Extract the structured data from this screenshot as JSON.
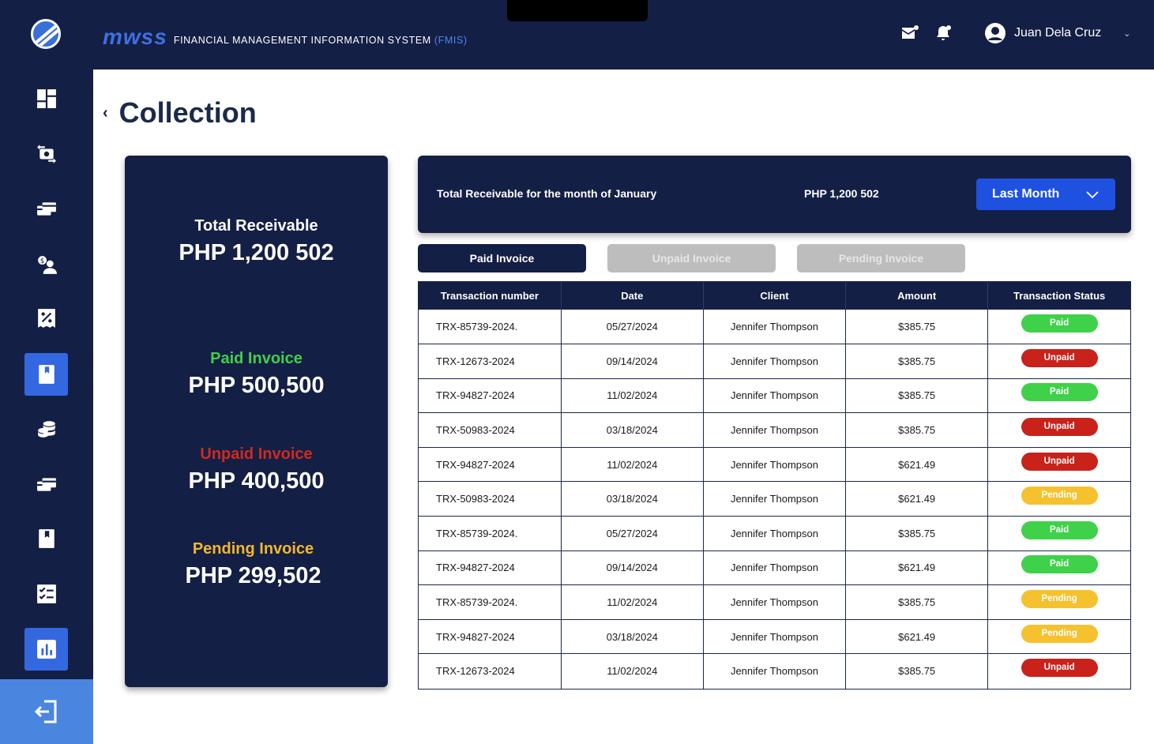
{
  "app": {
    "brand_logo": "mwss",
    "brand_title": "FINANCIAL MANAGEMENT INFORMATION SYSTEM",
    "brand_title_accent": "(FMIS)",
    "user_name": "Juan Dela Cruz",
    "caret": "⌄",
    "icons": [
      "mail-icon",
      "bell-icon",
      "user-avatar-icon"
    ]
  },
  "sidebar": {
    "items": [
      {
        "icon": "dashboard-icon",
        "active": false
      },
      {
        "icon": "money-exchange-icon",
        "active": false
      },
      {
        "icon": "card-transfer-icon",
        "active": false
      },
      {
        "icon": "client-payment-icon",
        "active": false
      },
      {
        "icon": "discount-receipt-icon",
        "active": false
      },
      {
        "icon": "ledger-book-icon",
        "active": true
      },
      {
        "icon": "coins-stack-icon",
        "active": false
      },
      {
        "icon": "card-stack-icon",
        "active": false
      },
      {
        "icon": "bookmark-book-icon",
        "active": false
      },
      {
        "icon": "checklist-icon",
        "active": false
      },
      {
        "icon": "report-chart-icon",
        "active": true
      }
    ],
    "logout_icon": "logout-icon"
  },
  "page": {
    "back_symbol": "‹",
    "title": "Collection"
  },
  "summary": {
    "total_label": "Total Receivable",
    "total_value": "PHP 1,200 502",
    "paid_label": "Paid Invoice",
    "paid_value": "PHP 500,500",
    "unpaid_label": "Unpaid Invoice",
    "unpaid_value": "PHP 400,500",
    "pending_label": "Pending Invoice",
    "pending_value": "PHP 299,502",
    "colors": {
      "paid": "#3fd14a",
      "unpaid": "#d02a1f",
      "pending": "#f3b72c"
    }
  },
  "banner": {
    "label": "Total Receivable for the month of January",
    "amount": "PHP 1,200 502",
    "period_selected": "Last Month"
  },
  "tabs": [
    {
      "label": "Paid Invoice",
      "active": true
    },
    {
      "label": "Unpaid Invoice",
      "active": false
    },
    {
      "label": "Pending Invoice",
      "active": false
    }
  ],
  "table": {
    "columns": [
      "Transaction number",
      "Date",
      "Client",
      "Amount",
      "Transaction Status"
    ],
    "rows": [
      {
        "txn": "TRX-85739-2024.",
        "date": "05/27/2024",
        "client": "Jennifer Thompson",
        "amount": "$385.75",
        "status": "Paid"
      },
      {
        "txn": "TRX-12673-2024",
        "date": "09/14/2024",
        "client": "Jennifer Thompson",
        "amount": "$385.75",
        "status": "Unpaid"
      },
      {
        "txn": "TRX-94827-2024",
        "date": "11/02/2024",
        "client": "Jennifer Thompson",
        "amount": "$385.75",
        "status": "Paid"
      },
      {
        "txn": "TRX-50983-2024",
        "date": "03/18/2024",
        "client": "Jennifer Thompson",
        "amount": "$385.75",
        "status": "Unpaid"
      },
      {
        "txn": "TRX-94827-2024",
        "date": "11/02/2024",
        "client": "Jennifer Thompson",
        "amount": "$621.49",
        "status": "Unpaid"
      },
      {
        "txn": "TRX-50983-2024",
        "date": "03/18/2024",
        "client": "Jennifer Thompson",
        "amount": "$621.49",
        "status": "Pending"
      },
      {
        "txn": "TRX-85739-2024.",
        "date": "05/27/2024",
        "client": "Jennifer Thompson",
        "amount": "$385.75",
        "status": "Paid"
      },
      {
        "txn": "TRX-94827-2024",
        "date": "09/14/2024",
        "client": "Jennifer Thompson",
        "amount": "$621.49",
        "status": "Paid"
      },
      {
        "txn": "TRX-85739-2024.",
        "date": "11/02/2024",
        "client": "Jennifer Thompson",
        "amount": "$385.75",
        "status": "Pending"
      },
      {
        "txn": "TRX-94827-2024",
        "date": "03/18/2024",
        "client": "Jennifer Thompson",
        "amount": "$621.49",
        "status": "Pending"
      },
      {
        "txn": "TRX-12673-2024",
        "date": "11/02/2024",
        "client": "Jennifer Thompson",
        "amount": "$385.75",
        "status": "Unpaid"
      }
    ],
    "status_colors": {
      "Paid": "#3fd14a",
      "Unpaid": "#c8221a",
      "Pending": "#f6c12e"
    }
  }
}
